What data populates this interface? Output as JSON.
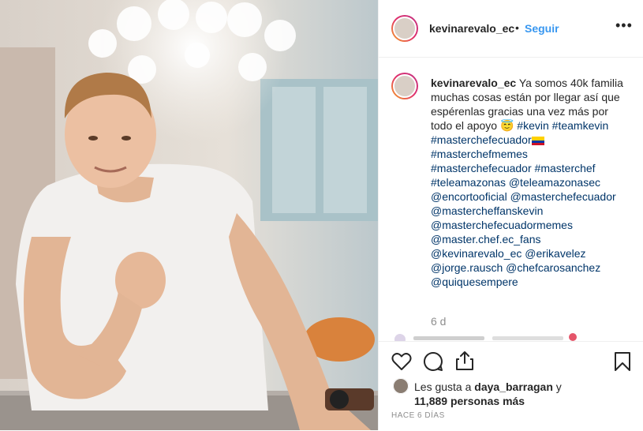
{
  "post": {
    "username": "kevinarevalo_ec",
    "follow_label": "Seguir",
    "dot": "•",
    "more": "•••",
    "caption_text": "Ya somos 40k familia muchas cosas están por llegar así que espérenlas gracias una vez más por todo el apoyo",
    "hashtags_line1": [
      "#kevin",
      "#teamkevin",
      "#masterchefecuador"
    ],
    "hashtags_line2": [
      "#masterchefmemes",
      "#masterchefecuador",
      "#masterchef",
      "#teleamazonas"
    ],
    "mentions": [
      "@teleamazonasec",
      "@encortooficial",
      "@masterchefecuador",
      "@mastercheffanskevin",
      "@masterchefecuadormemes",
      "@master.chef.ec_fans",
      "@kevinarevalo_ec",
      "@erikavelez",
      "@jorge.rausch",
      "@chefcarosanchez",
      "@quiquesempere"
    ],
    "time_ago": "6 d",
    "likes_prefix": "Les gusta a",
    "liked_by_user": "daya_barragan",
    "likes_y": "y",
    "likes_count": "11,889 personas más",
    "date": "HACE 6 DÍAS"
  },
  "icons": {
    "like": "heart-icon",
    "comment": "comment-icon",
    "share": "share-icon",
    "save": "bookmark-icon",
    "emoji": "angel-emoji-icon",
    "flag": "ecuador-flag-icon"
  },
  "colors": {
    "link": "#003569",
    "follow": "#3897f0",
    "muted": "#8e8e8e",
    "text": "#262626"
  }
}
